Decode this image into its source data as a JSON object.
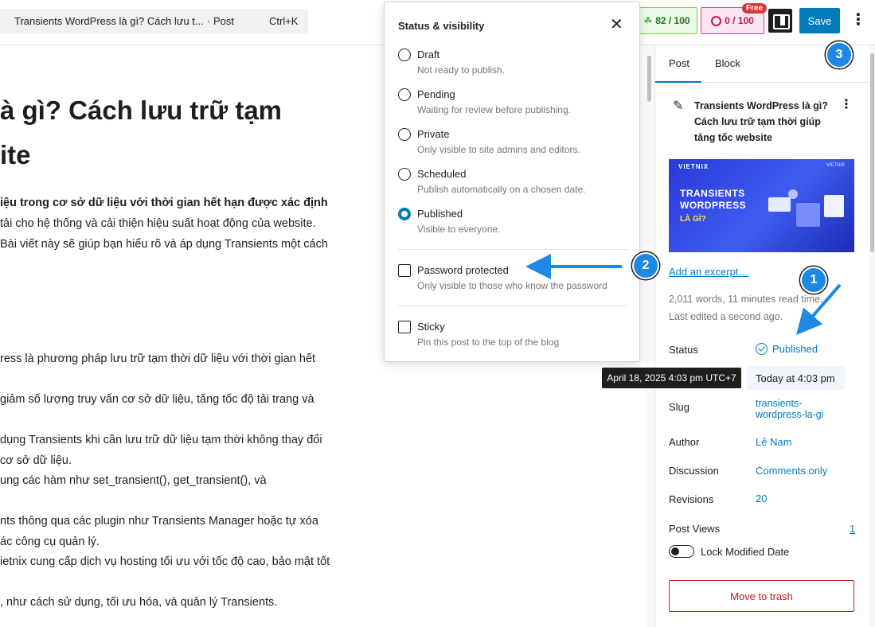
{
  "topbar": {
    "command_title": "Transients WordPress là gì? Cách lưu t...",
    "command_type": "· Post",
    "command_shortcut": "Ctrl+K",
    "seo_score": "82 / 100",
    "readability_score": "0 / 100",
    "free_badge": "Free",
    "save_label": "Save"
  },
  "editor": {
    "heading_line1": "à gì? Cách lưu trữ tạm",
    "heading_line2": "ite",
    "paragraphs": [
      {
        "text": "iệu trong cơ sở dữ liệu với thời gian hết hạn được xác định",
        "bold": true
      },
      {
        "text": "tải cho hệ thống và cải thiện hiệu suất hoạt động của website.",
        "bold": false
      },
      {
        "text": "Bài viết này sẽ giúp bạn hiểu rõ và áp dụng Transients một cách",
        "bold": false
      },
      {
        "text": "ress là phương pháp lưu trữ tạm thời dữ liệu với thời gian hết",
        "bold": false
      },
      {
        "text": "giảm số lượng truy vấn cơ sở dữ liệu, tăng tốc độ tải trang và",
        "bold": false
      },
      {
        "text": "dụng Transients khi cần lưu trữ dữ liệu tạm thời không thay đổi",
        "bold": false
      },
      {
        "text": "cơ sở dữ liệu.",
        "bold": false
      },
      {
        "text": "ung các hàm như set_transient(), get_transient(), và",
        "bold": false
      },
      {
        "text": "nts thông qua các plugin như Transients Manager hoặc tự xóa",
        "bold": false
      },
      {
        "text": "ác công cụ quản lý.",
        "bold": false
      },
      {
        "text": "ietnix cung cấp dịch vụ hosting tối ưu với tốc độ cao, bảo mật tốt",
        "bold": false
      },
      {
        "text": ", như cách sử dụng, tối ưu hóa, và quản lý Transients.",
        "bold": false
      }
    ]
  },
  "popover": {
    "title": "Status & visibility",
    "close_icon": "close-icon",
    "options": [
      {
        "label": "Draft",
        "desc": "Not ready to publish.",
        "checked": false
      },
      {
        "label": "Pending",
        "desc": "Waiting for review before publishing.",
        "checked": false
      },
      {
        "label": "Private",
        "desc": "Only visible to site admins and editors.",
        "checked": false
      },
      {
        "label": "Scheduled",
        "desc": "Publish automatically on a chosen date.",
        "checked": false
      },
      {
        "label": "Published",
        "desc": "Visible to everyone.",
        "checked": true
      }
    ],
    "password": {
      "label": "Password protected",
      "desc": "Only visible to those who know the password",
      "checked": false
    },
    "sticky": {
      "label": "Sticky",
      "desc": "Pin this post to the top of the blog",
      "checked": false
    }
  },
  "sidebar": {
    "tabs": {
      "post": "Post",
      "block": "Block"
    },
    "post_title": "Transients WordPress là gì? Cách lưu trữ tạm thời giúp tăng tốc website",
    "thumbnail": {
      "brand": "VIETNIX",
      "brand_right": "VIETNIX",
      "line1": "TRANSIENTS",
      "line2": "WORDPRESS",
      "line3": "LÀ GÌ?"
    },
    "excerpt_link": "Add an excerpt…",
    "words": "2,011 words, 11 minutes read time.",
    "last_edited": "Last edited a second ago.",
    "status_label": "Status",
    "status_value": "Published",
    "publish_value": "Today at 4:03 pm",
    "slug_label": "Slug",
    "slug_value": "transients-wordpress-la-gi",
    "author_label": "Author",
    "author_value": "Lê Nam",
    "discussion_label": "Discussion",
    "discussion_value": "Comments only",
    "revisions_label": "Revisions",
    "revisions_value": "20",
    "views_label": "Post Views",
    "views_value": "1",
    "lock_label": "Lock Modified Date",
    "trash_label": "Move to trash"
  },
  "tooltip": "April 18, 2025 4:03 pm UTC+7",
  "annotations": {
    "badge1": "1",
    "badge2": "2",
    "badge3": "3",
    "color": "#1e88e5"
  },
  "colors": {
    "accent": "#007cba",
    "trash": "#cc1818",
    "seo": "#7ad03a",
    "readability": "#d63f8c"
  }
}
